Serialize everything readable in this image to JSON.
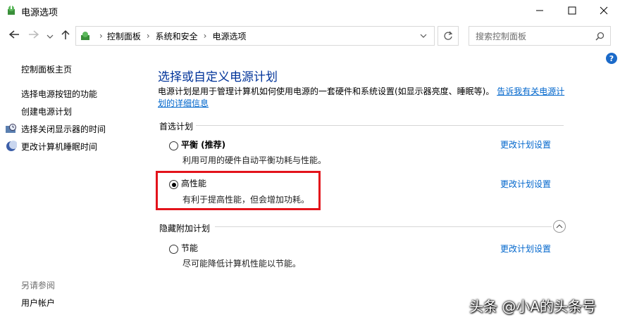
{
  "window": {
    "title": "电源选项"
  },
  "breadcrumb": [
    "控制面板",
    "系统和安全",
    "电源选项"
  ],
  "search": {
    "placeholder": "搜索控制面板"
  },
  "sidebar": {
    "home": "控制面板主页",
    "items": [
      "选择电源按钮的功能",
      "创建电源计划",
      "选择关闭显示器的时间",
      "更改计算机睡眠时间"
    ],
    "see_also_title": "另请参阅",
    "see_also_items": [
      "用户帐户"
    ]
  },
  "main": {
    "heading": "选择或自定义电源计划",
    "description": "电源计划是用于管理计算机如何使用电源的一套硬件和系统设置(如显示器亮度、睡眠等)。",
    "learn_more": "告诉我有关电源计划的详细信息",
    "preferred_title": "首选计划",
    "hidden_title": "隐藏附加计划",
    "plans": [
      {
        "name": "平衡 (推荐)",
        "desc": "利用可用的硬件自动平衡功耗与性能。",
        "selected": false,
        "link": "更改计划设置"
      },
      {
        "name": "高性能",
        "desc": "有利于提高性能，但会增加功耗。",
        "selected": true,
        "link": "更改计划设置"
      },
      {
        "name": "节能",
        "desc": "尽可能降低计算机性能以节能。",
        "selected": false,
        "link": "更改计划设置"
      }
    ]
  },
  "watermark": "头条 @小A的头条号",
  "colors": {
    "highlight_box": "#e3131b",
    "link": "#0066cc",
    "heading": "#003399"
  }
}
